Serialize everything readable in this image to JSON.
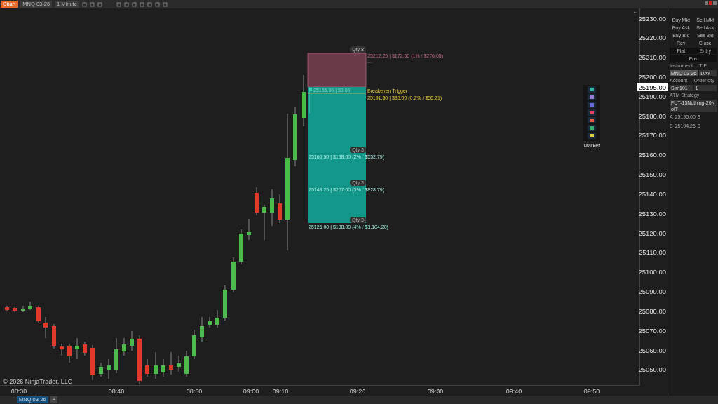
{
  "toolbar": {
    "chart_button": "Chart",
    "instrument": "MNQ 03-26",
    "interval": "1 Minute"
  },
  "chart": {
    "price_axis": [
      "25230.00",
      "25220.00",
      "25210.00",
      "25200.00",
      "25190.00",
      "25180.00",
      "25170.00",
      "25160.00",
      "25150.00",
      "25140.00",
      "25130.00",
      "25120.00",
      "25110.00",
      "25100.00",
      "25090.00",
      "25080.00",
      "25070.00",
      "25060.00",
      "25050.00"
    ],
    "current_price": "25195.00",
    "time_axis": [
      "08:30",
      "08:40",
      "08:50",
      "09:00",
      "09:10",
      "09:20",
      "09:30",
      "09:40",
      "09:50"
    ],
    "copyright": "© 2026 NinjaTrader, LLC",
    "collapse_arrow": "←",
    "position": {
      "stop_qty": "Qty 8",
      "stop_label": "25212.25 | $172.50 (1% / $276.05)",
      "stop_note": "---",
      "entry_label": "25195.00 | $0.00",
      "breakeven_title": "Breakeven Trigger",
      "breakeven_label": "25191.50 | $35.00 (0.2% / $55.21)",
      "targets": [
        {
          "qty": "Qty 3",
          "label": "25160.50 | $138.00 (2% / $552.79)"
        },
        {
          "qty": "Qty 3",
          "label": "25143.25 | $207.00 (3% / $828.79)"
        },
        {
          "qty": "Qty 3",
          "label": "25126.00 | $138.00 (4% / $1,104.20)"
        }
      ]
    },
    "order_toolbar": {
      "market_label": "Market"
    }
  },
  "order_panel": {
    "buttons": [
      {
        "label": "Buy Mkt"
      },
      {
        "label": "Sell Mkt"
      },
      {
        "label": "Buy Ask"
      },
      {
        "label": "Sell Ask"
      },
      {
        "label": "Buy Bid"
      },
      {
        "label": "Sell Bid"
      },
      {
        "label": "Rev"
      },
      {
        "label": "Close"
      }
    ],
    "dark_buttons": [
      {
        "label": "Flat"
      },
      {
        "label": "Entry"
      }
    ],
    "pos_button": "Pos",
    "instrument_label": "Instrument",
    "tif_label": "TIF",
    "instrument_value": "MNQ 03-26",
    "tif_value": "DAY",
    "account_label": "Account",
    "qty_label": "Order qty",
    "account_value": "Sim101",
    "qty_value": "1",
    "atm_label": "ATM Strategy",
    "atm_value": "FUT-15Nothing-20NotT",
    "brackets": [
      {
        "side": "A",
        "price": "25195.00",
        "qty": "3"
      },
      {
        "side": "B",
        "price": "25194.25",
        "qty": "3"
      }
    ]
  },
  "tabs": [
    {
      "label": "MNQ 03-26",
      "selected": true
    }
  ],
  "add_tab": "+"
}
